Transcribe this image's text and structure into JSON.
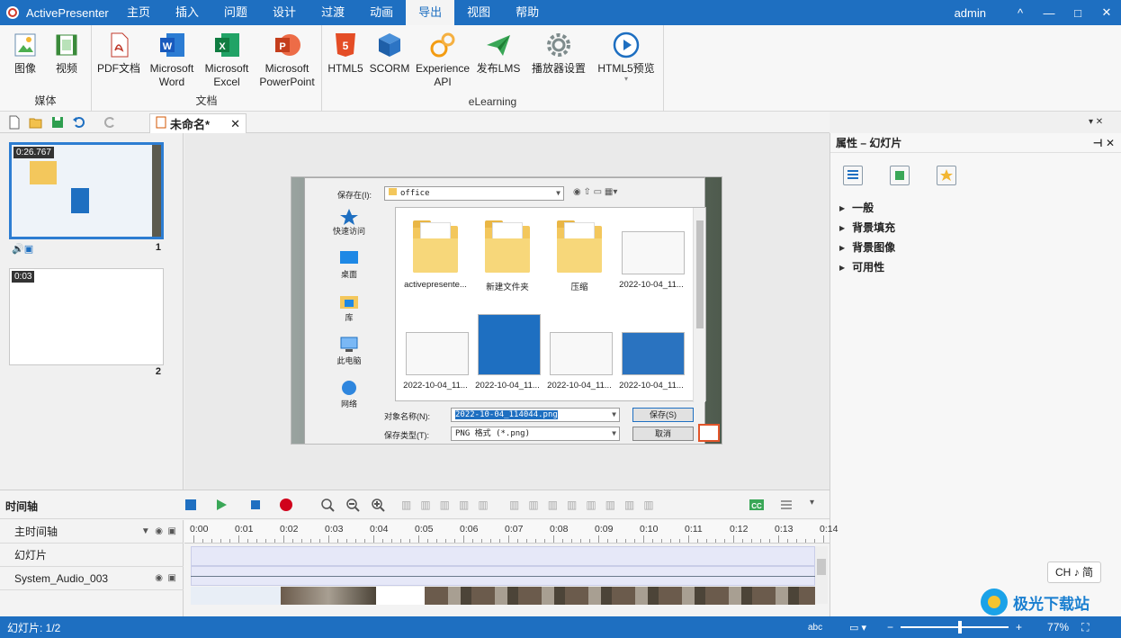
{
  "app": {
    "title": "ActivePresenter",
    "user": "admin"
  },
  "menu": [
    "主页",
    "插入",
    "问题",
    "设计",
    "过渡",
    "动画",
    "导出",
    "视图",
    "帮助"
  ],
  "active_menu": "导出",
  "window_controls": [
    "^",
    "—",
    "□",
    "✕"
  ],
  "ribbon": {
    "groups": [
      {
        "label": "媒体",
        "buttons": [
          "图像",
          "视频"
        ]
      },
      {
        "label": "文档",
        "buttons": [
          "PDF文档",
          "Microsoft Word",
          "Microsoft Excel",
          "Microsoft PowerPoint"
        ]
      },
      {
        "label": "eLearning",
        "buttons": [
          "HTML5",
          "SCORM",
          "Experience API",
          "发布LMS",
          "播放器设置",
          "HTML5预览"
        ]
      }
    ]
  },
  "doc_tab": {
    "title": "未命名*",
    "close": "✕"
  },
  "slides": [
    {
      "time": "0:26.767",
      "num": "1"
    },
    {
      "time": "0:03",
      "num": "2"
    }
  ],
  "dialog": {
    "save_in_label": "保存在(I):",
    "save_in_value": "office",
    "places": [
      "快速访问",
      "桌面",
      "库",
      "此电脑",
      "网络"
    ],
    "files": [
      "activepresente...",
      "新建文件夹",
      "压缩",
      "2022-10-04_11...",
      "2022-10-04_11...",
      "2022-10-04_11...",
      "2022-10-04_11...",
      "2022-10-04_11..."
    ],
    "name_label": "对象名称(N):",
    "name_value": "2022-10-04_114044.png",
    "type_label": "保存类型(T):",
    "type_value": "PNG 格式 (*.png)",
    "save_btn": "保存(S)",
    "cancel_btn": "取消"
  },
  "props": {
    "title": "属性 – 幻灯片",
    "sections": [
      "一般",
      "背景填充",
      "背景图像",
      "可用性"
    ]
  },
  "timeline": {
    "label": "时间轴",
    "tracks": [
      "主时间轴",
      "幻灯片",
      "System_Audio_003"
    ],
    "ruler": [
      "0:00",
      "0:01",
      "0:02",
      "0:03",
      "0:04",
      "0:05",
      "0:06",
      "0:07",
      "0:08",
      "0:09",
      "0:10",
      "0:11",
      "0:12",
      "0:13",
      "0:14"
    ]
  },
  "status": {
    "slide": "幻灯片: 1/2",
    "zoom": "77%",
    "zoom_level": 0.55
  },
  "ime": "CH ♪ 简",
  "watermark": "极光下载站",
  "colors": {
    "accent": "#1e6fc1",
    "status": "#1e6fc1"
  }
}
